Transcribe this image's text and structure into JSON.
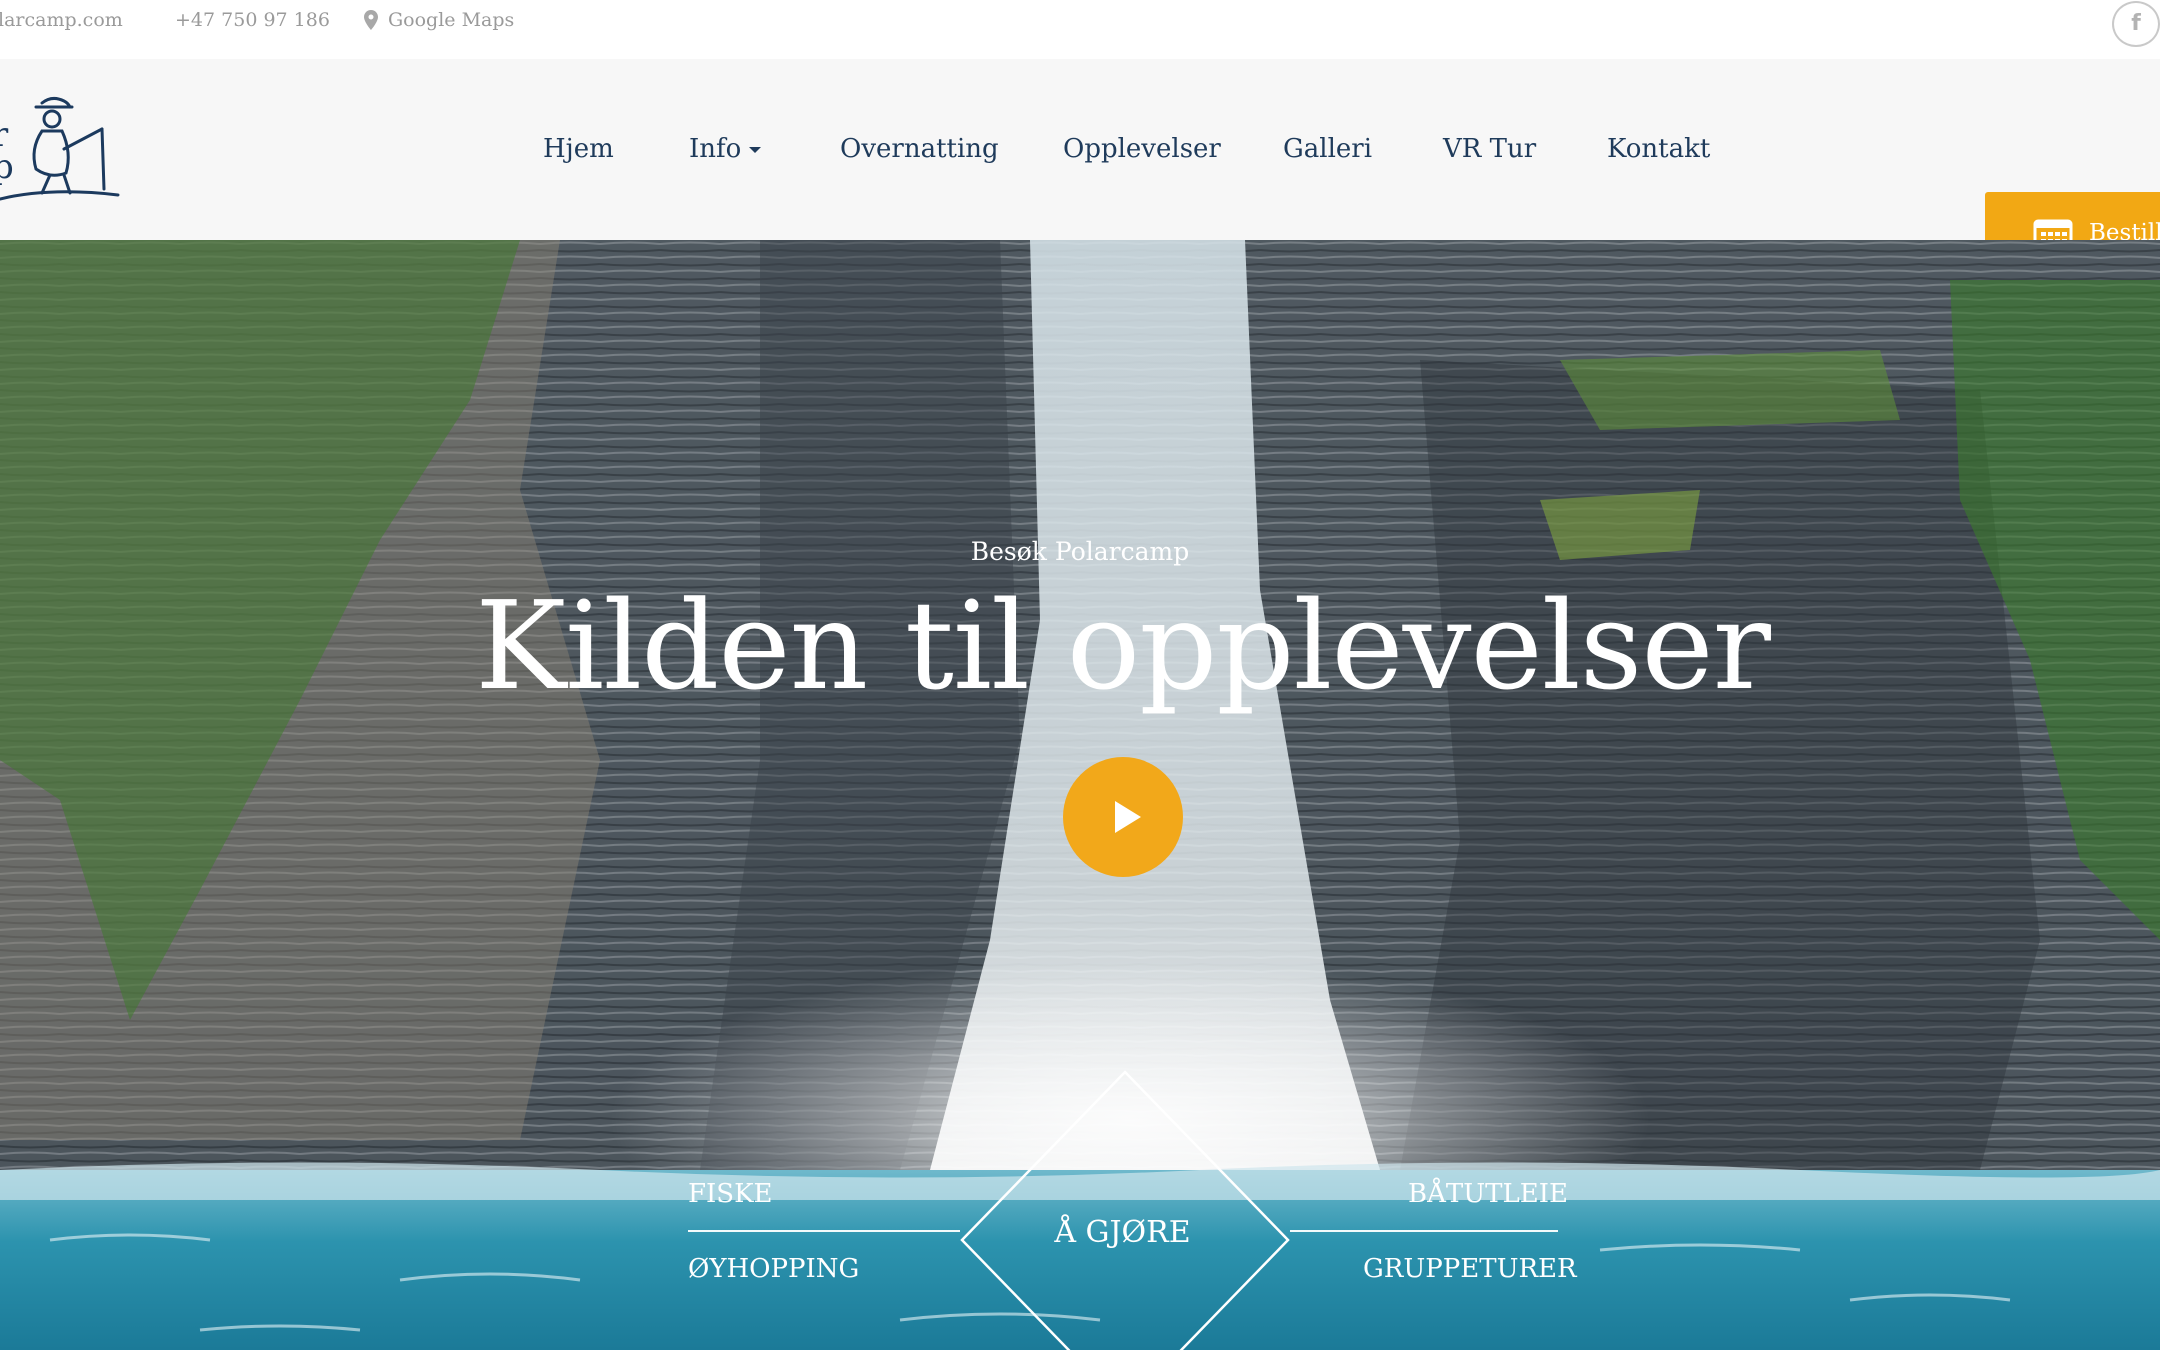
{
  "topbar": {
    "email": "larcamp.com",
    "phone": "+47 750 97 186",
    "maps_label": "Google Maps",
    "facebook_glyph": "f"
  },
  "header": {
    "logo_text": "r\np",
    "nav": {
      "home": "Hjem",
      "info": "Info",
      "overnatting": "Overnatting",
      "opplevelser": "Opplevelser",
      "galleri": "Galleri",
      "vrtur": "VR Tur",
      "kontakt": "Kontakt"
    },
    "book_label": "Bestill"
  },
  "hero": {
    "kicker": "Besøk Polarcamp",
    "headline": "Kilden til opplevelser",
    "center_label": "Å GJØRE",
    "activities": {
      "fiske": "FISKE",
      "oyhopping": "ØYHOPPING",
      "batutleie": "BÅTUTLEIE",
      "gruppeturer": "GRUPPETURER"
    }
  },
  "colors": {
    "accent": "#f2a814",
    "nav_text": "#1f3b5b",
    "header_bg": "#f7f7f7"
  },
  "icons": [
    "map-pin-icon",
    "facebook-icon",
    "calendar-icon",
    "play-icon",
    "logo-fisherman-icon"
  ]
}
